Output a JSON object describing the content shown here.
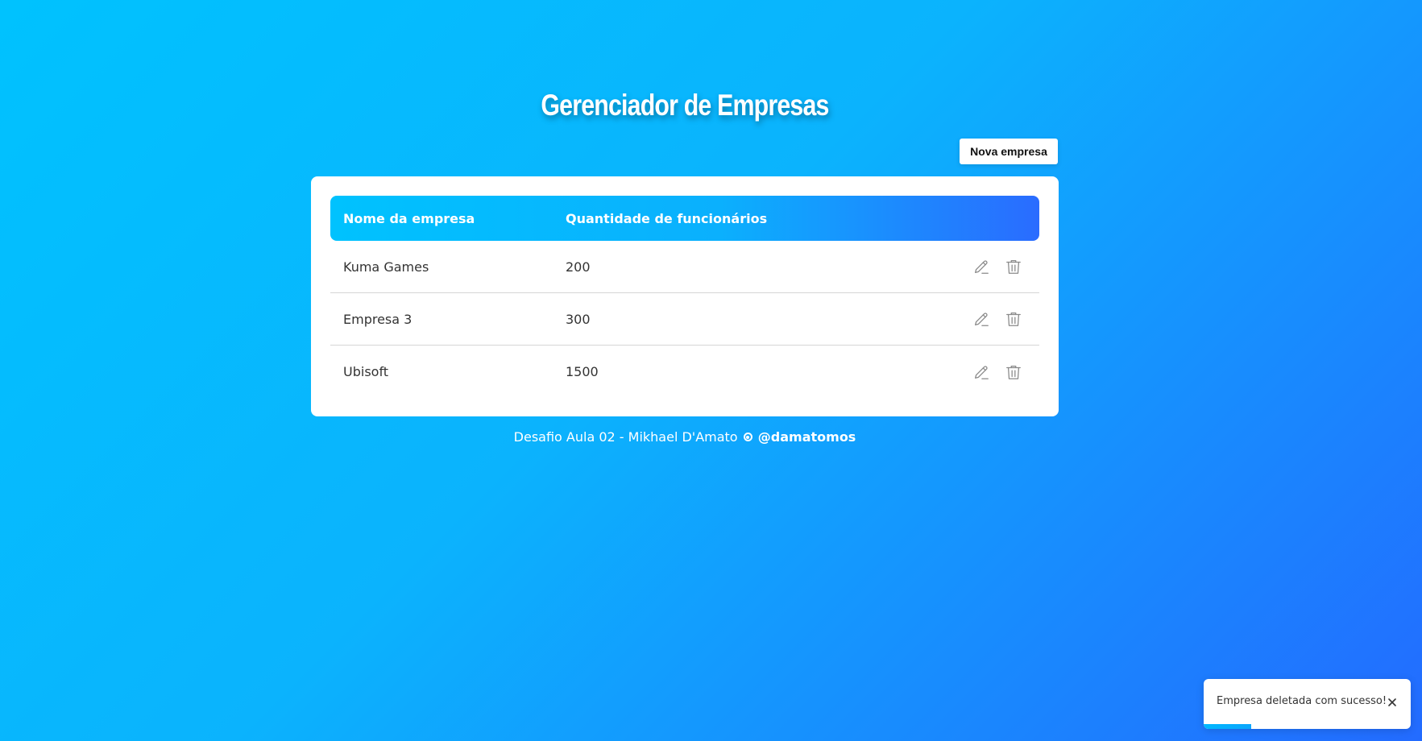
{
  "page": {
    "title": "Gerenciador de Empresas"
  },
  "toolbar": {
    "new_label": "Nova empresa"
  },
  "table": {
    "headers": [
      "Nome da empresa",
      "Quantidade de funcionários"
    ],
    "rows": [
      {
        "name": "Kuma Games",
        "qty": "200"
      },
      {
        "name": "Empresa 3",
        "qty": "300"
      },
      {
        "name": "Ubisoft",
        "qty": "1500"
      }
    ],
    "row_icons": [
      "pencil-icon",
      "trash-icon"
    ]
  },
  "footer": {
    "text": "Desafio Aula 02 - Mikhael D'Amato",
    "handle": "@damatomos",
    "icon": "instagram-icon"
  },
  "toast": {
    "message": "Empresa deletada com sucesso!",
    "progress_fraction": 0.23
  },
  "colors": {
    "background_start": "#00c2fe",
    "background_end": "#236bff",
    "header_gradient_end": "#2a6cff",
    "icon_gray": "#8a8a8a"
  }
}
